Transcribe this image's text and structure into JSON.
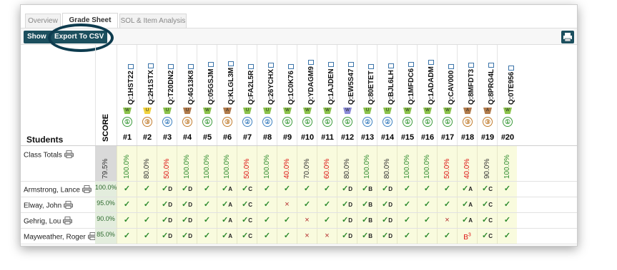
{
  "tabs": [
    {
      "label": "Overview"
    },
    {
      "label": "Grade Sheet"
    },
    {
      "label": "SOL & Item Analysis"
    }
  ],
  "toolbar": {
    "show_label": "Show",
    "export_label": "Export To CSV",
    "print_icon": "printer-icon"
  },
  "header": {
    "students_label": "Students",
    "score_label": "SCORE"
  },
  "questions": [
    {
      "id": "Q:1HST22",
      "num": "#1",
      "tag": "W",
      "tag_color": "#8bc34a",
      "level": "①",
      "level_color": "#3a9a3a"
    },
    {
      "id": "Q:2H1STX",
      "num": "#2",
      "tag": "U",
      "tag_color": "#f0d23c",
      "level": "③",
      "level_color": "#c07a2a"
    },
    {
      "id": "Q:T20DN2",
      "num": "#3",
      "tag": "U",
      "tag_color": "#8bc34a",
      "level": "②",
      "level_color": "#3a7fbf"
    },
    {
      "id": "Q:4G13K8",
      "num": "#4",
      "tag": "U",
      "tag_color": "#b07a4a",
      "level": "③",
      "level_color": "#c07a2a"
    },
    {
      "id": "Q:05GSJM",
      "num": "#5",
      "tag": "W",
      "tag_color": "#8bc34a",
      "level": "①",
      "level_color": "#3a9a3a"
    },
    {
      "id": "Q:KLGL3M",
      "num": "#6",
      "tag": "A",
      "tag_color": "#b07a4a",
      "level": "③",
      "level_color": "#c07a2a"
    },
    {
      "id": "Q:FA2L5R",
      "num": "#7",
      "tag": "U",
      "tag_color": "#8bc34a",
      "level": "②",
      "level_color": "#3a7fbf"
    },
    {
      "id": "Q:26YCHX",
      "num": "#8",
      "tag": "U",
      "tag_color": "#8bc34a",
      "level": "②",
      "level_color": "#3a7fbf"
    },
    {
      "id": "Q:1C0K76",
      "num": "#9",
      "tag": "W",
      "tag_color": "#8bc34a",
      "level": "①",
      "level_color": "#3a9a3a"
    },
    {
      "id": "Q:YDAGM9",
      "num": "#10",
      "tag": "W",
      "tag_color": "#8bc34a",
      "level": "①",
      "level_color": "#3a9a3a"
    },
    {
      "id": "Q:1AJDEN",
      "num": "#11",
      "tag": "W",
      "tag_color": "#8bc34a",
      "level": "①",
      "level_color": "#3a9a3a"
    },
    {
      "id": "Q:EW5S47",
      "num": "#12",
      "tag": "W",
      "tag_color": "#8a8ad8",
      "level": "①",
      "level_color": "#3a9a3a"
    },
    {
      "id": "Q:80ETET",
      "num": "#13",
      "tag": "U",
      "tag_color": "#8bc34a",
      "level": "②",
      "level_color": "#3a7fbf"
    },
    {
      "id": "Q:BJL6LH",
      "num": "#14",
      "tag": "U",
      "tag_color": "#8bc34a",
      "level": "②",
      "level_color": "#3a7fbf"
    },
    {
      "id": "Q:1MFDC6",
      "num": "#15",
      "tag": "W",
      "tag_color": "#8bc34a",
      "level": "①",
      "level_color": "#3a9a3a"
    },
    {
      "id": "Q:1ADADM",
      "num": "#16",
      "tag": "W",
      "tag_color": "#8bc34a",
      "level": "①",
      "level_color": "#3a9a3a"
    },
    {
      "id": "Q:CAV000",
      "num": "#17",
      "tag": "W",
      "tag_color": "#8bc34a",
      "level": "①",
      "level_color": "#3a9a3a"
    },
    {
      "id": "Q:8MFDT3",
      "num": "#18",
      "tag": "A",
      "tag_color": "#b07a4a",
      "level": "③",
      "level_color": "#c07a2a"
    },
    {
      "id": "Q:8PRG4L",
      "num": "#19",
      "tag": "A",
      "tag_color": "#b07a4a",
      "level": "③",
      "level_color": "#c07a2a"
    },
    {
      "id": "Q:0TE956",
      "num": "#20",
      "tag": "W",
      "tag_color": "#8bc34a",
      "level": "①",
      "level_color": "#3a9a3a"
    }
  ],
  "class_totals": {
    "label": "Class Totals",
    "score": "79.5%",
    "values": [
      "100.0%",
      "80.0%",
      "50.0%",
      "100.0%",
      "100.0%",
      "100.0%",
      "50.0%",
      "100.0%",
      "40.0%",
      "70.0%",
      "60.0%",
      "80.0%",
      "100.0%",
      "80.0%",
      "100.0%",
      "100.0%",
      "50.0%",
      "40.0%",
      "90.0%",
      "100.0%"
    ],
    "colors": [
      "#2c8a2c",
      "#333",
      "#d11",
      "#2c8a2c",
      "#2c8a2c",
      "#2c8a2c",
      "#d11",
      "#2c8a2c",
      "#d11",
      "#333",
      "#d11",
      "#333",
      "#2c8a2c",
      "#333",
      "#2c8a2c",
      "#2c8a2c",
      "#d11",
      "#d11",
      "#333",
      "#2c8a2c"
    ]
  },
  "students": [
    {
      "name": "Armstrong, Lance",
      "score": "100.0%",
      "cells": [
        "✓",
        "✓",
        "✓D",
        "✓D",
        "✓",
        "✓A",
        "✓C",
        "✓",
        "✓",
        "✓",
        "✓",
        "✓D",
        "✓B",
        "✓D",
        "✓",
        "✓",
        "✓",
        "✓A",
        "✓C",
        "✓"
      ]
    },
    {
      "name": "Elway, John",
      "score": "95.0%",
      "cells": [
        "✓",
        "✓",
        "✓D",
        "✓D",
        "✓",
        "✓A",
        "✓C",
        "✓",
        "×",
        "✓",
        "✓",
        "✓D",
        "✓B",
        "✓D",
        "✓",
        "✓",
        "✓",
        "✓A",
        "✓C",
        "✓"
      ]
    },
    {
      "name": "Gehrig, Lou",
      "score": "90.0%",
      "cells": [
        "✓",
        "✓",
        "✓D",
        "✓D",
        "✓",
        "✓A",
        "✓C",
        "✓",
        "✓",
        "×",
        "✓",
        "✓D",
        "✓B",
        "✓D",
        "✓",
        "✓",
        "×",
        "✓A",
        "✓C",
        "✓"
      ]
    },
    {
      "name": "Mayweather, Roger",
      "score": "85.0%",
      "cells": [
        "✓",
        "✓",
        "✓D",
        "✓D",
        "✓",
        "✓A",
        "✓C",
        "✓",
        "✓",
        "×",
        "×",
        "✓D",
        "✓B",
        "✓D",
        "✓",
        "✓",
        "✓",
        "B3",
        "✓C",
        "✓"
      ]
    }
  ]
}
